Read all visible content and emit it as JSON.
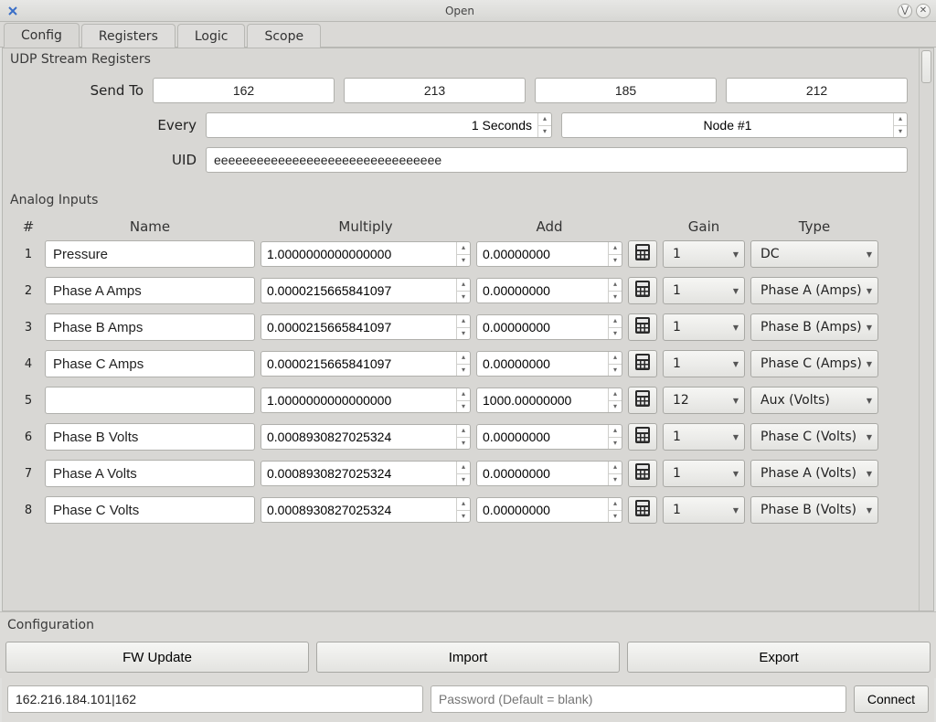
{
  "window": {
    "title": "Open"
  },
  "tabs": [
    "Config",
    "Registers",
    "Logic",
    "Scope"
  ],
  "active_tab": 0,
  "udp": {
    "section_label": "UDP Stream Registers",
    "send_to_label": "Send To",
    "every_label": "Every",
    "uid_label": "UID",
    "send_to": [
      "162",
      "213",
      "185",
      "212"
    ],
    "every_value": "1 Seconds",
    "every_node": "Node #1",
    "uid": "eeeeeeeeeeeeeeeeeeeeeeeeeeeeeeee"
  },
  "analog": {
    "section_label": "Analog Inputs",
    "headers": {
      "idx": "#",
      "name": "Name",
      "mul": "Multiply",
      "add": "Add",
      "gain": "Gain",
      "type": "Type"
    },
    "rows": [
      {
        "idx": "1",
        "name": "Pressure",
        "mul": "1.0000000000000000",
        "add": "0.00000000",
        "gain": "1",
        "type": "DC"
      },
      {
        "idx": "2",
        "name": "Phase A Amps",
        "mul": "0.0000215665841097",
        "add": "0.00000000",
        "gain": "1",
        "type": "Phase A (Amps)"
      },
      {
        "idx": "3",
        "name": "Phase B Amps",
        "mul": "0.0000215665841097",
        "add": "0.00000000",
        "gain": "1",
        "type": "Phase B (Amps)"
      },
      {
        "idx": "4",
        "name": "Phase C Amps",
        "mul": "0.0000215665841097",
        "add": "0.00000000",
        "gain": "1",
        "type": "Phase C (Amps)"
      },
      {
        "idx": "5",
        "name": "",
        "mul": "1.0000000000000000",
        "add": "1000.00000000",
        "gain": "12",
        "type": "Aux (Volts)"
      },
      {
        "idx": "6",
        "name": "Phase B Volts",
        "mul": "0.0008930827025324",
        "add": "0.00000000",
        "gain": "1",
        "type": "Phase C (Volts)"
      },
      {
        "idx": "7",
        "name": "Phase A Volts",
        "mul": "0.0008930827025324",
        "add": "0.00000000",
        "gain": "1",
        "type": "Phase A (Volts)"
      },
      {
        "idx": "8",
        "name": "Phase C Volts",
        "mul": "0.0008930827025324",
        "add": "0.00000000",
        "gain": "1",
        "type": "Phase B (Volts)"
      }
    ]
  },
  "configuration": {
    "section_label": "Configuration",
    "buttons": {
      "fw": "FW Update",
      "import": "Import",
      "export": "Export"
    }
  },
  "connection": {
    "host": "162.216.184.101|162",
    "password_placeholder": "Password (Default = blank)",
    "connect_label": "Connect"
  }
}
